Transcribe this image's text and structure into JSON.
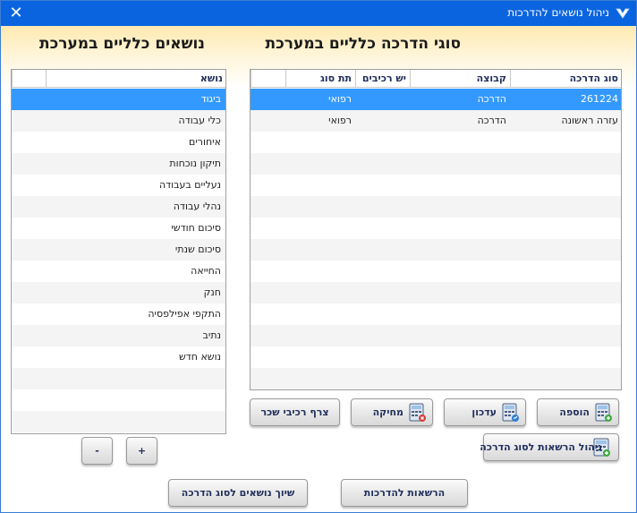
{
  "window": {
    "title": "ניהול נושאים להדרכות",
    "close_glyph": "✕"
  },
  "headings": {
    "training_types": "סוגי הדרכה כלליים במערכת",
    "topics": "נושאים כלליים במערכת"
  },
  "training_types_grid": {
    "columns": [
      "סוג הדרכה",
      "קבוצה",
      "יש רכיבים",
      "תת סוג"
    ],
    "rows": [
      {
        "type": "261224",
        "group": "הדרכה",
        "has_components": "",
        "subtype": "רפואי",
        "selected": true
      },
      {
        "type": "עזרה ראשונה",
        "group": "הדרכה",
        "has_components": "",
        "subtype": "רפואי",
        "selected": false
      }
    ]
  },
  "topics_grid": {
    "column": "נושא",
    "rows": [
      "ביגוד",
      "כלי עבודה",
      "איחורים",
      "תיקון נוכחות",
      "נעליים בעבודה",
      "נהלי עבודה",
      "סיכום חודשי",
      "סיכום שנתי",
      "החייאה",
      "חנק",
      "התקפי אפילפסיה",
      "נתיב",
      "נושא חדש"
    ]
  },
  "buttons": {
    "add": "הוספה",
    "edit": "עדכון",
    "delete": "מחיקה",
    "attach_components": "צרף רכיבי שכר",
    "manage_registrations": "ניהול הרשאות לסוג הדרכה",
    "plus": "+",
    "minus": "-",
    "registrations": "הרשאות להדרכות",
    "assign_topics": "שיוך נושאים לסוג הדרכה"
  },
  "icons": {
    "app": "app-logo-icon",
    "add": "calculator-add-icon",
    "edit": "calculator-edit-icon",
    "delete": "calculator-delete-icon",
    "manage": "calculator-permissions-icon"
  },
  "colors": {
    "titlebar": "#0a64e0",
    "selection": "#3399ff",
    "header_text": "#1f2d5a"
  }
}
